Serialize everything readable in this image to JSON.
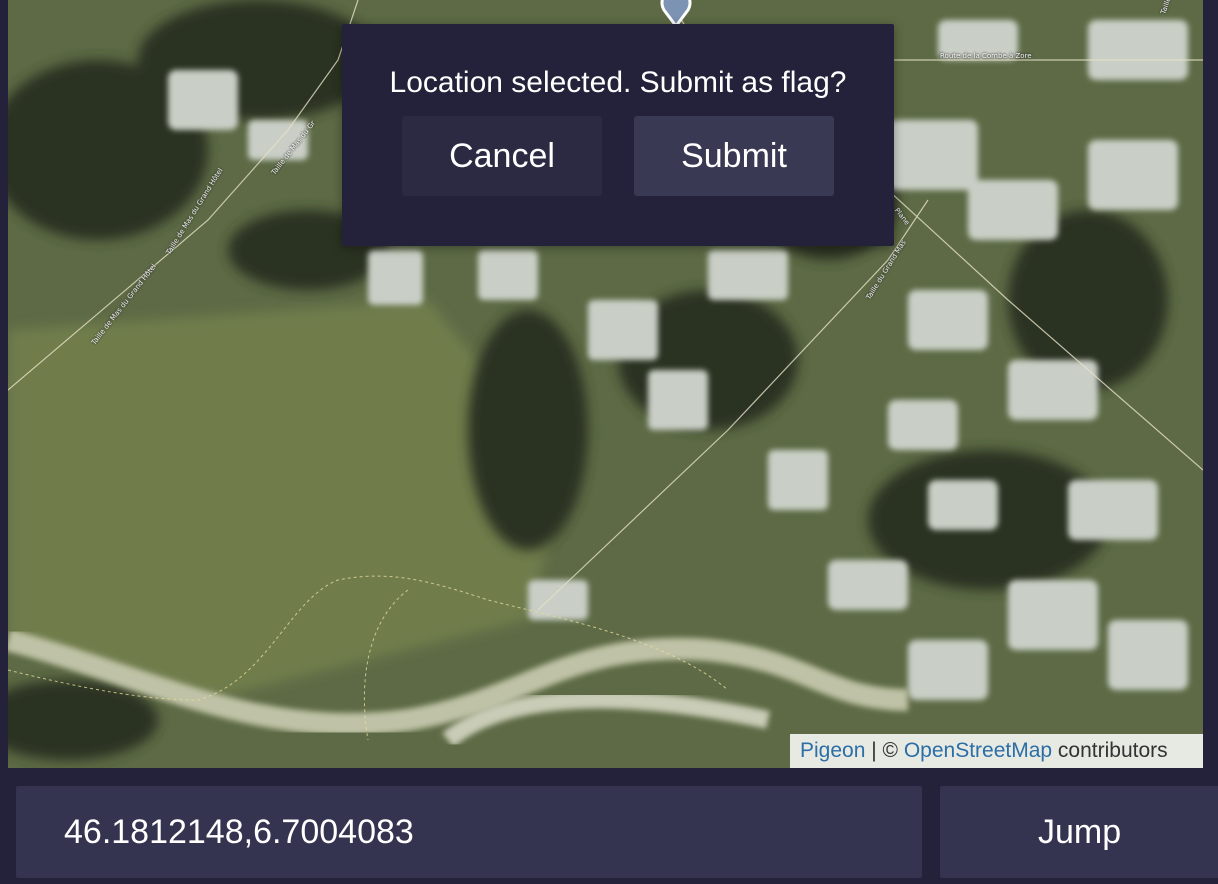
{
  "map": {
    "road_labels": [
      "Taille de Mas du Grand Hôtel",
      "Taille de Mas du Gr",
      "Taille de Mas du Grand Hôtel",
      "Route de la Combe à Zore",
      "Taille du Grand Mas",
      "Taille du Grand Mas",
      "Plane"
    ],
    "pin_icon": "location-pin-icon",
    "attribution": {
      "pigeon": "Pigeon",
      "separator": " | © ",
      "osm": "OpenStreetMap",
      "suffix": " contributors"
    }
  },
  "dialog": {
    "title": "Location selected. Submit as flag?",
    "cancel_label": "Cancel",
    "submit_label": "Submit"
  },
  "coordinates": {
    "value": "46.1812148,6.7004083"
  },
  "jump": {
    "label": "Jump"
  },
  "colors": {
    "background": "#23223a",
    "button": "#353450",
    "link": "#2c6ea6"
  }
}
